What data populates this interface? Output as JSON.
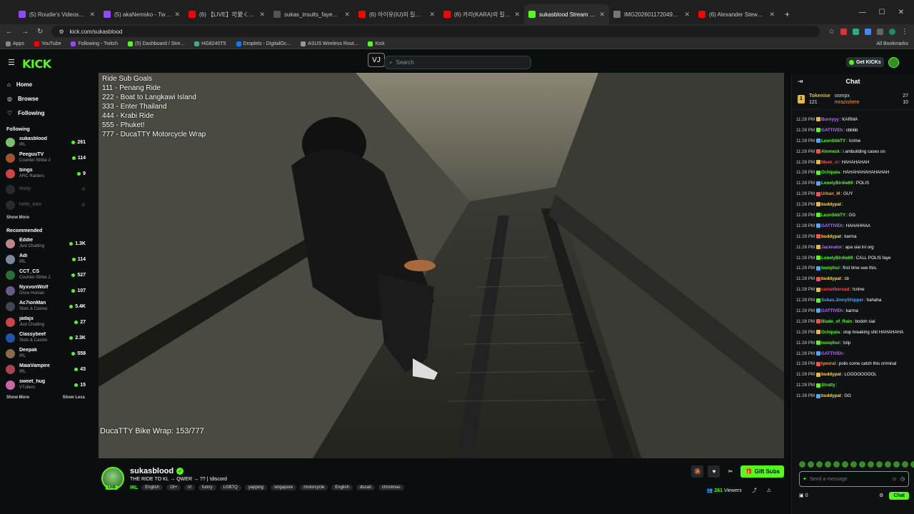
{
  "browser": {
    "tabs": [
      {
        "label": "(5) Roudie's Videos - Twitch",
        "color": "#9146ff",
        "active": false
      },
      {
        "label": "(5) akaNemsko - Twitch",
        "color": "#9146ff",
        "active": false
      },
      {
        "label": "(6) 【LIVE】可愛くてごめん／「若田部",
        "color": "#ff0000",
        "active": false
      },
      {
        "label": "sukas_insults_faye_middle_fing",
        "color": "#555555",
        "active": false
      },
      {
        "label": "(6) 아이유(IU)의 킬링보이스를",
        "color": "#ff0000",
        "active": false
      },
      {
        "label": "(6) 카라(KARA)의 킬링보이스를",
        "color": "#ff0000",
        "active": false
      },
      {
        "label": "sukasblood Stream - Watch",
        "color": "#53fc18",
        "active": true
      },
      {
        "label": "IMG20260117204933.jpg (307",
        "color": "#777777",
        "active": false
      },
      {
        "label": "(6) Alexander Stewart - The Wr",
        "color": "#ff0000",
        "active": false
      }
    ],
    "url": "kick.com/sukasblood",
    "bookmarks": [
      "Apps",
      "YouTube",
      "Following - Twitch",
      "(5) Dashboard / Stre...",
      "HG8240T5",
      "Droplets - DigitalOc...",
      "ASUS Wireless Rout...",
      "Kick"
    ],
    "all_bookmarks": "All Bookmarks"
  },
  "header": {
    "logo": "KICK",
    "vj": "VJ",
    "search_placeholder": "Search",
    "get_kicks": "Get KICKs"
  },
  "sidebar": {
    "nav": [
      {
        "label": "Home",
        "icon": "home-icon"
      },
      {
        "label": "Browse",
        "icon": "compass-icon"
      },
      {
        "label": "Following",
        "icon": "heart-icon"
      }
    ],
    "following_title": "Following",
    "following": [
      {
        "name": "sukasblood",
        "cat": "IRL",
        "viewers": "261",
        "color": "#7fbf6a",
        "online": true
      },
      {
        "name": "PeeguuTV",
        "cat": "Counter-Strike 2",
        "viewers": "114",
        "color": "#a0522d",
        "online": true
      },
      {
        "name": "bings",
        "cat": "ARC Raiders",
        "viewers": "9",
        "color": "#c44",
        "online": true
      },
      {
        "name": "ihsity",
        "cat": "",
        "viewers": "",
        "color": "#555",
        "online": false
      },
      {
        "name": "hello_kiko",
        "cat": "",
        "viewers": "",
        "color": "#555",
        "online": false
      }
    ],
    "show_more": "Show More",
    "recommended_title": "Recommended",
    "recommended": [
      {
        "name": "Eddie",
        "cat": "Just Chatting",
        "viewers": "1.3K",
        "color": "#b88"
      },
      {
        "name": "Adi",
        "cat": "IRL",
        "viewers": "114",
        "color": "#7a8a9a"
      },
      {
        "name": "CCT_CS",
        "cat": "Counter-Strike 2",
        "viewers": "527",
        "color": "#2c6b3a"
      },
      {
        "name": "NyxvonWolf",
        "cat": "Once Human",
        "viewers": "107",
        "color": "#6a5a8a"
      },
      {
        "name": "Ac7ionMan",
        "cat": "Slots & Casino",
        "viewers": "5.4K",
        "color": "#445"
      },
      {
        "name": "jadajx",
        "cat": "Just Chatting",
        "viewers": "27",
        "color": "#c44"
      },
      {
        "name": "Classybeef",
        "cat": "Slots & Casino",
        "viewers": "2.3K",
        "color": "#2255aa"
      },
      {
        "name": "Deepak",
        "cat": "IRL",
        "viewers": "558",
        "color": "#8a6a4a"
      },
      {
        "name": "MaiaVampire",
        "cat": "IRL",
        "viewers": "43",
        "color": "#a45"
      },
      {
        "name": "sweet_hug",
        "cat": "VTubers",
        "viewers": "15",
        "color": "#c6a"
      }
    ],
    "show_more_2": "Show More",
    "show_less": "Show Less"
  },
  "video": {
    "goals": [
      "Ride Sub Goals",
      "111 - Penang Ride",
      "222 - Boat to Langkawi Island",
      "333 - Enter Thailand",
      "444 - Krabi Ride",
      "555 - Phuket!",
      "777 - DucaTTY Motorcycle Wrap"
    ],
    "wrap_label": "DucaTTY Bike Wrap: 153/777"
  },
  "stream": {
    "live": "LIVE",
    "name": "sukasblood",
    "title": "THE RIDE TO KL → QWER → ?? | !discord",
    "category": "IRL",
    "tags": [
      "English",
      "18+",
      "irl",
      "funny",
      "LGBTQ",
      "yapping",
      "singapore",
      "motorcycle",
      "English",
      "ducati",
      "christmas"
    ],
    "gift_subs": "Gift Subs",
    "viewers": "261",
    "viewers_label": "Viewers"
  },
  "chat": {
    "title": "Chat",
    "leaderboard": [
      {
        "name": "Tokenise",
        "count": "121"
      },
      {
        "name": "oompx",
        "count": "27"
      },
      {
        "name": "mrazishere",
        "count": "10"
      }
    ],
    "messages": [
      {
        "time": "11:28 PM",
        "user": "Burnyyy",
        "color": "#b56cff",
        "text": "KARMA"
      },
      {
        "time": "11:28 PM",
        "user": "GATTIVEh",
        "color": "#b56cff",
        "text": "cbbbb"
      },
      {
        "time": "11:28 PM",
        "user": "LeonSkbTY",
        "color": "#53fc18",
        "text": "!crime"
      },
      {
        "time": "11:28 PM",
        "user": "Atomezk",
        "color": "#53fc18",
        "text": "i ambuilding cases on"
      },
      {
        "time": "11:28 PM",
        "user": "Meek_ci",
        "color": "#ff4d4d",
        "text": "HAHAHAHAH"
      },
      {
        "time": "11:28 PM",
        "user": "Ochipala",
        "color": "#53fc18",
        "text": "HAHAHAHAHAHAHAH"
      },
      {
        "time": "11:28 PM",
        "user": "LonelyBirdie69",
        "color": "#53fc18",
        "text": "POLIS"
      },
      {
        "time": "11:28 PM",
        "user": "Urban_M",
        "color": "#ff9a3c",
        "text": "GUY"
      },
      {
        "time": "11:28 PM",
        "user": "buddypat",
        "color": "#ffd84a",
        "text": ""
      },
      {
        "time": "11:28 PM",
        "user": "LeonSkbTY",
        "color": "#53fc18",
        "text": "GG"
      },
      {
        "time": "11:28 PM",
        "user": "GATTIVEh",
        "color": "#b56cff",
        "text": "HAHAHHAA"
      },
      {
        "time": "11:28 PM",
        "user": "buddypat",
        "color": "#ffd84a",
        "text": "karma"
      },
      {
        "time": "11:28 PM",
        "user": "Jacknator",
        "color": "#b56cff",
        "text": "apa siai ini org"
      },
      {
        "time": "11:28 PM",
        "user": "LonelyBirdie69",
        "color": "#53fc18",
        "text": "CALL POLIS faye"
      },
      {
        "time": "11:28 PM",
        "user": "looiqihui",
        "color": "#53fc18",
        "text": "first time see this."
      },
      {
        "time": "11:28 PM",
        "user": "buddypat",
        "color": "#ffd84a",
        "text": "cb"
      },
      {
        "time": "11:28 PM",
        "user": "cursetheroad",
        "color": "#ff4d4d",
        "text": "!crime"
      },
      {
        "time": "11:28 PM",
        "user": "Sukas.JinnyShipper",
        "color": "#4da6ff",
        "text": "hahaha"
      },
      {
        "time": "11:28 PM",
        "user": "GATTIVEh",
        "color": "#b56cff",
        "text": "karma"
      },
      {
        "time": "11:28 PM",
        "user": "Blade_of_Rain",
        "color": "#53fc18",
        "text": "bodoh siai"
      },
      {
        "time": "11:28 PM",
        "user": "Ochipala",
        "color": "#53fc18",
        "text": "stop breaking shit HAHAHAHA"
      },
      {
        "time": "11:28 PM",
        "user": "looiqihui",
        "color": "#53fc18",
        "text": "!clip"
      },
      {
        "time": "11:28 PM",
        "user": "GATTIVEh",
        "color": "#b56cff",
        "text": ""
      },
      {
        "time": "11:28 PM",
        "user": "tyeoral",
        "color": "#ff9a3c",
        "text": "polis come catch this criminal"
      },
      {
        "time": "11:28 PM",
        "user": "buddypat",
        "color": "#ffd84a",
        "text": "LOOOOOOOOL"
      },
      {
        "time": "11:28 PM",
        "user": "Stratty",
        "color": "#53fc18",
        "text": ""
      },
      {
        "time": "11:28 PM",
        "user": "buddypat",
        "color": "#ffd84a",
        "text": "GG"
      }
    ],
    "input_placeholder": "Send a message",
    "points": "0",
    "send": "Chat"
  },
  "colors": {
    "kick_green": "#53fc18",
    "bg": "#0b0e0f"
  }
}
